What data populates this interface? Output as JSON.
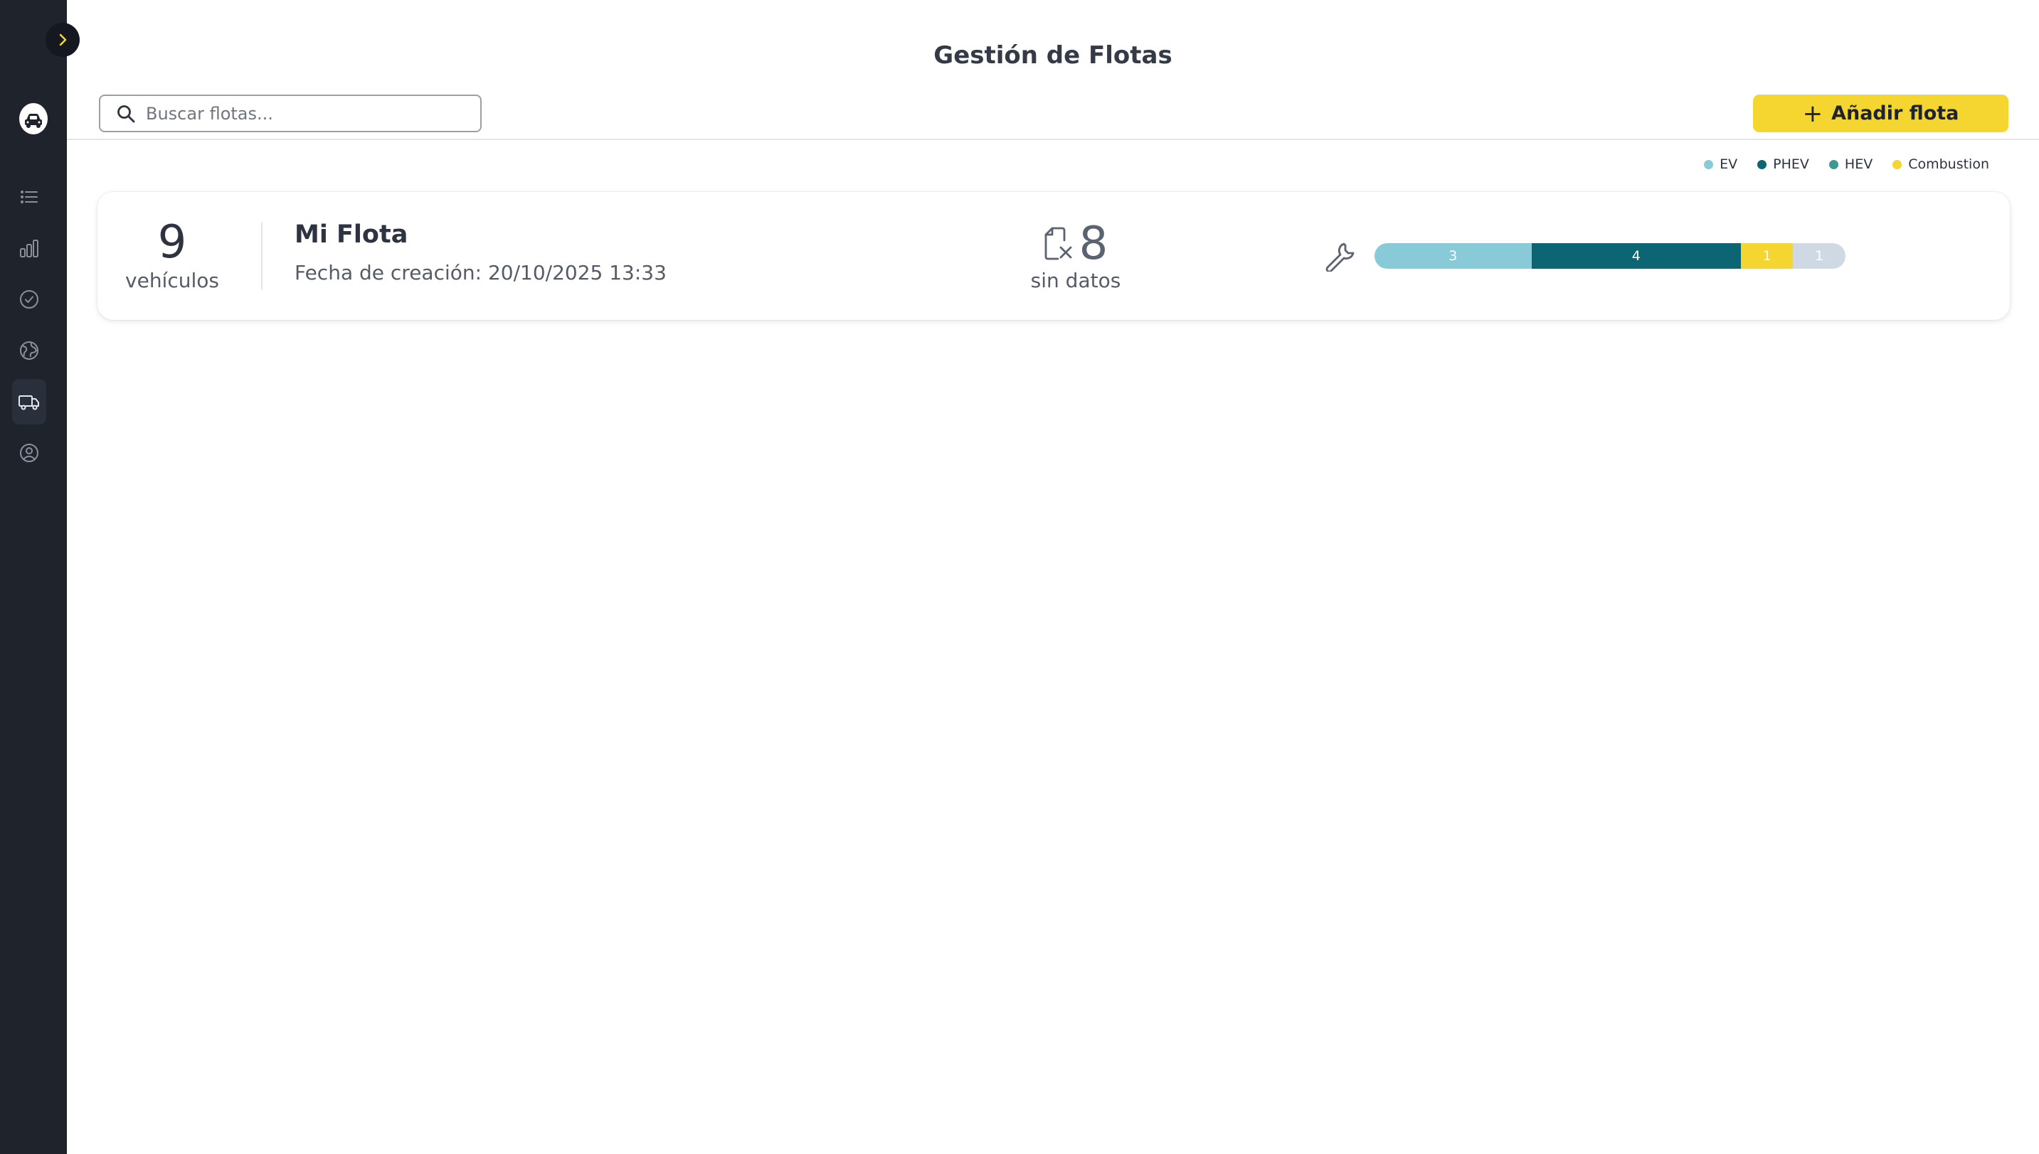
{
  "app": {
    "page_title": "Gestión de Flotas"
  },
  "colors": {
    "sidebar_bg": "#1f232c",
    "accent": "#f5d530",
    "ev": "#88cad8",
    "phev": "#0c6572",
    "hev": "#3d9990",
    "combustion": "#f5d530",
    "unknown": "#cfd9e3"
  },
  "sidebar": {
    "toggle_icon": "chevron-right-icon",
    "logo_icon": "car-logo-icon",
    "items": [
      {
        "icon": "list-icon",
        "active": false
      },
      {
        "icon": "bar-chart-icon",
        "active": false
      },
      {
        "icon": "check-circle-icon",
        "active": false
      },
      {
        "icon": "globe-icon",
        "active": false
      },
      {
        "icon": "truck-icon",
        "active": true
      },
      {
        "icon": "user-circle-icon",
        "active": false
      }
    ]
  },
  "toolbar": {
    "search_placeholder": "Buscar flotas...",
    "add_label": "Añadir flota"
  },
  "legend": [
    {
      "label": "EV",
      "color": "#88cad8"
    },
    {
      "label": "PHEV",
      "color": "#0c6572"
    },
    {
      "label": "HEV",
      "color": "#3d9990"
    },
    {
      "label": "Combustion",
      "color": "#f5d530"
    }
  ],
  "fleets": [
    {
      "vehicle_count": "9",
      "vehicle_label": "vehículos",
      "name": "Mi Flota",
      "created_label": "Fecha de creación: 20/10/2025 13:33",
      "no_data_count": "8",
      "no_data_label": "sin datos",
      "composition": [
        {
          "type": "EV",
          "count": 3,
          "color": "#88cad8"
        },
        {
          "type": "PHEV",
          "count": 4,
          "color": "#0c6572"
        },
        {
          "type": "Combustion",
          "count": 1,
          "color": "#f5d530"
        },
        {
          "type": "unknown",
          "count": 1,
          "color": "#cfd9e3"
        }
      ]
    }
  ]
}
